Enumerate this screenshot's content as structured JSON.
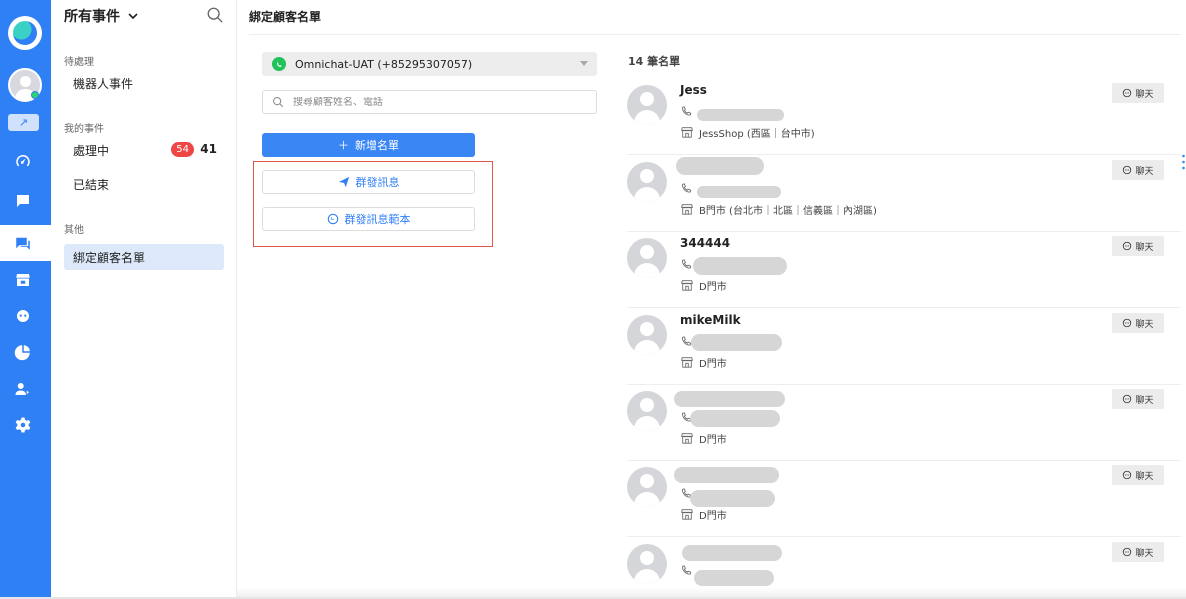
{
  "sidebar": {
    "header": "所有事件",
    "sections": {
      "pending": "待處理",
      "mine": "我的事件",
      "other": "其他"
    },
    "items": {
      "bot_events": "機器人事件",
      "processing": "處理中",
      "processing_badge": "54",
      "processing_count": "41",
      "closed": "已結束",
      "binding_list": "綁定顧客名單"
    }
  },
  "main": {
    "title": "綁定顧客名單",
    "channel": "Omnichat-UAT (+85295307057)",
    "search_placeholder": "搜尋顧客姓名、電話",
    "add_button": "新增名單",
    "broadcast_button": "群發訊息",
    "broadcast_template_button": "群發訊息範本",
    "list_count": "14 筆名單"
  },
  "customers": [
    {
      "name": "Jess",
      "store": "JessShop (西區｜台中市)",
      "chat": "聊天"
    },
    {
      "name": "",
      "store": "B門市 (台北市｜北區｜信義區｜內湖區)",
      "chat": "聊天"
    },
    {
      "name": "344444",
      "store": "D門市",
      "chat": "聊天"
    },
    {
      "name": "mikeMilk",
      "store": "D門市",
      "chat": "聊天"
    },
    {
      "name": "",
      "store": "D門市",
      "chat": "聊天"
    },
    {
      "name": "",
      "store": "D門市",
      "chat": "聊天"
    },
    {
      "name": "",
      "store": "",
      "chat": "聊天"
    }
  ],
  "icons": {
    "rail": [
      "dashboard-icon",
      "chat-bubble-icon",
      "conversation-icon",
      "store-icon",
      "bot-icon",
      "pie-chart-icon",
      "contacts-icon",
      "settings-icon"
    ],
    "trend": "↗"
  },
  "colors": {
    "brand": "#2f7ff5",
    "badge": "#ee4545",
    "whatsapp": "#23c15a",
    "highlight_frame": "#e2574c"
  }
}
